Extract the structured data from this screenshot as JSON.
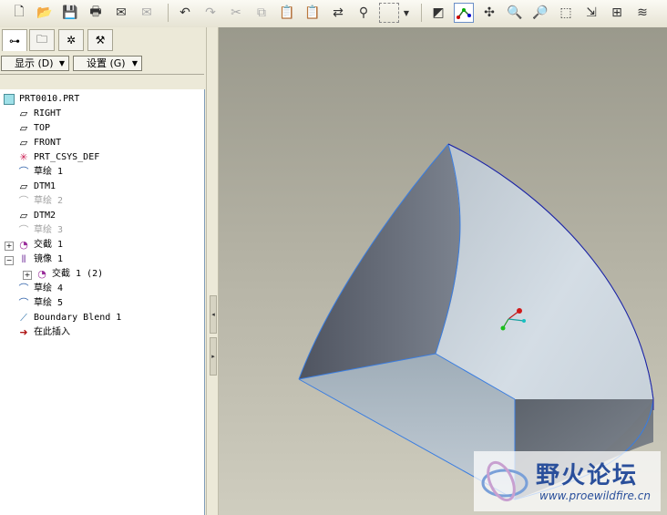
{
  "toolbar": {
    "icons": [
      "new-file",
      "open-folder",
      "save",
      "print",
      "email",
      "send",
      "undo",
      "redo",
      "cut",
      "copy",
      "paste",
      "paste-special",
      "regenerate",
      "find",
      "select-box",
      "dropdown",
      "view-orient",
      "datum-display",
      "spin-center",
      "zoom-in",
      "zoom-out",
      "refit",
      "pan-view",
      "annotation",
      "layers"
    ]
  },
  "tabs": [
    "model-tree",
    "layers",
    "favorites",
    "tools"
  ],
  "buttons": {
    "display": "显示 (D)",
    "settings": "设置 (G)"
  },
  "tree": {
    "root": "PRT0010.PRT",
    "items": [
      {
        "label": "RIGHT",
        "icon": "datum-plane"
      },
      {
        "label": "TOP",
        "icon": "datum-plane"
      },
      {
        "label": "FRONT",
        "icon": "datum-plane"
      },
      {
        "label": "PRT_CSYS_DEF",
        "icon": "csys"
      },
      {
        "label": "草绘 1",
        "icon": "sketch"
      },
      {
        "label": "DTM1",
        "icon": "datum-plane"
      },
      {
        "label": "草绘 2",
        "icon": "sketch",
        "hidden": true
      },
      {
        "label": "DTM2",
        "icon": "datum-plane"
      },
      {
        "label": "草绘 3",
        "icon": "sketch",
        "hidden": true
      },
      {
        "label": "交截 1",
        "icon": "intersect",
        "expandable": true
      },
      {
        "label": "镜像 1",
        "icon": "mirror",
        "expanded": true
      },
      {
        "label": "交截 1 (2)",
        "icon": "intersect",
        "expandable": true,
        "child": true
      },
      {
        "label": "草绘 4",
        "icon": "sketch"
      },
      {
        "label": "草绘 5",
        "icon": "sketch"
      },
      {
        "label": "Boundary Blend 1",
        "icon": "boundary-blend"
      },
      {
        "label": "在此插入",
        "icon": "insert-arrow"
      }
    ]
  },
  "watermark": {
    "title": "野火论坛",
    "url": "www.proewildfire.cn"
  },
  "colors": {
    "surface_light": "#c9d3dc",
    "surface_dark": "#5d6470",
    "edge": "#3a7de0"
  }
}
